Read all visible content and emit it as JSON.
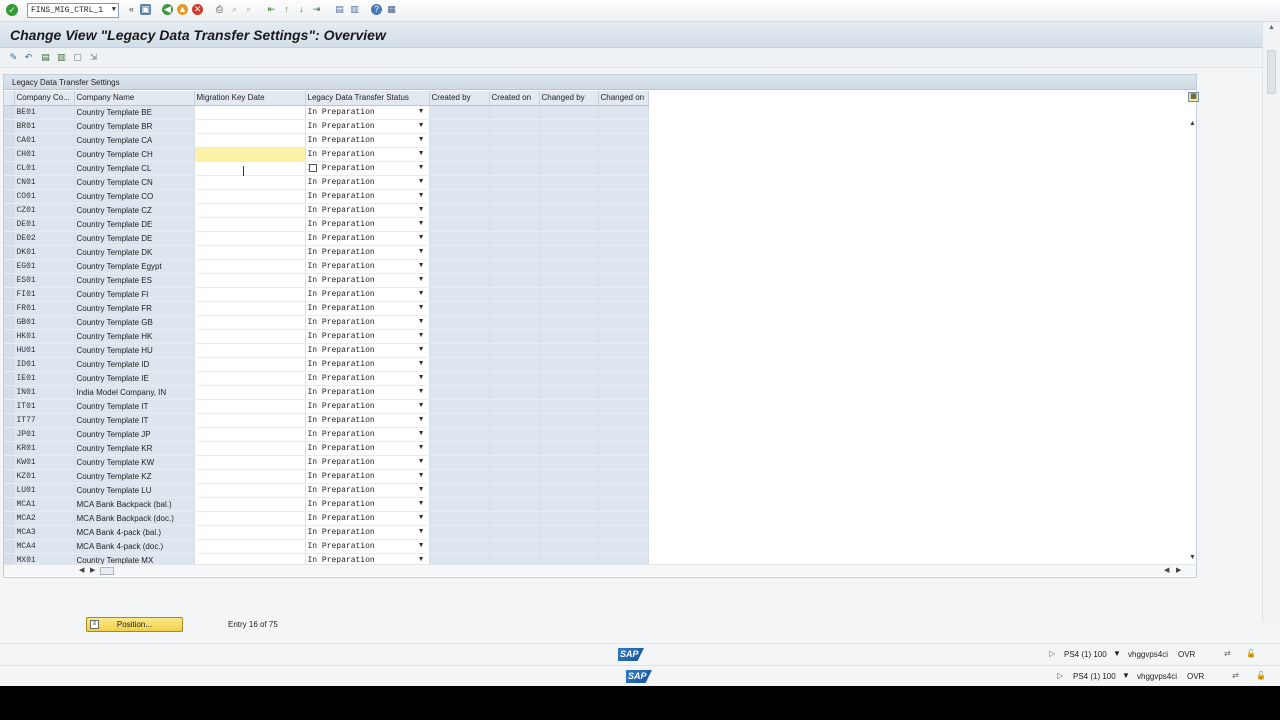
{
  "toolbar": {
    "transaction": "FINS_MIG_CTRL_1"
  },
  "title": "Change View \"Legacy Data Transfer Settings\": Overview",
  "group_title": "Legacy Data Transfer Settings",
  "columns": [
    "Company Co...",
    "Company Name",
    "Migration Key Date",
    "Legacy Data Transfer Status",
    "Created by",
    "Created on",
    "Changed by",
    "Changed on"
  ],
  "status_value": "In Preparation",
  "rows": [
    {
      "code": "BE01",
      "name": "Country Template BE"
    },
    {
      "code": "BR01",
      "name": "Country Template BR"
    },
    {
      "code": "CA01",
      "name": "Country Template CA"
    },
    {
      "code": "CH01",
      "name": "Country Template CH"
    },
    {
      "code": "CL01",
      "name": "Country Template CL"
    },
    {
      "code": "CN01",
      "name": "Country Template CN"
    },
    {
      "code": "CO01",
      "name": "Country Template CO"
    },
    {
      "code": "CZ01",
      "name": "Country Template CZ"
    },
    {
      "code": "DE01",
      "name": "Country Template DE"
    },
    {
      "code": "DE02",
      "name": "Country Template DE"
    },
    {
      "code": "DK01",
      "name": "Country Template DK"
    },
    {
      "code": "EG01",
      "name": "Country Template Egypt"
    },
    {
      "code": "ES01",
      "name": "Country Template ES"
    },
    {
      "code": "FI01",
      "name": "Country Template FI"
    },
    {
      "code": "FR01",
      "name": "Country Template FR"
    },
    {
      "code": "GB01",
      "name": "Country Template GB"
    },
    {
      "code": "HK01",
      "name": "Country Template HK"
    },
    {
      "code": "HU01",
      "name": "Country Template HU"
    },
    {
      "code": "ID01",
      "name": "Country Template ID"
    },
    {
      "code": "IE01",
      "name": "Country Template IE"
    },
    {
      "code": "IN01",
      "name": "India Model Company, IN"
    },
    {
      "code": "IT01",
      "name": "Country Template IT"
    },
    {
      "code": "IT77",
      "name": "Country Template IT"
    },
    {
      "code": "JP01",
      "name": "Country Template JP"
    },
    {
      "code": "KR01",
      "name": "Country Template KR"
    },
    {
      "code": "KW01",
      "name": "Country Template KW"
    },
    {
      "code": "KZ01",
      "name": "Country Template KZ"
    },
    {
      "code": "LU01",
      "name": "Country Template LU"
    },
    {
      "code": "MCA1",
      "name": "MCA Bank Backpack (bal.)"
    },
    {
      "code": "MCA2",
      "name": "MCA Bank Backpack (doc.)"
    },
    {
      "code": "MCA3",
      "name": "MCA Bank 4-pack (bal.)"
    },
    {
      "code": "MCA4",
      "name": "MCA Bank 4-pack (doc.)"
    },
    {
      "code": "MX01",
      "name": "Country Template MX"
    }
  ],
  "focused_row": 3,
  "position_button": "Position...",
  "entry_info": "Entry 16 of 75",
  "status_bar": {
    "system": "PS4 (1) 100",
    "server": "vhggvps4ci",
    "mode": "OVR",
    "logo": "SAP"
  },
  "icons": {
    "ok": "check-circle-icon",
    "save": "save-icon",
    "back": "back-icon",
    "exit": "exit-icon",
    "cancel": "cancel-icon",
    "print": "print-icon",
    "find": "find-icon",
    "help": "help-icon"
  },
  "colors": {
    "focus_cell": "#fdf2a8",
    "button_yellow": "#efcf4c",
    "key_cell_bg": "#dde6ef"
  }
}
